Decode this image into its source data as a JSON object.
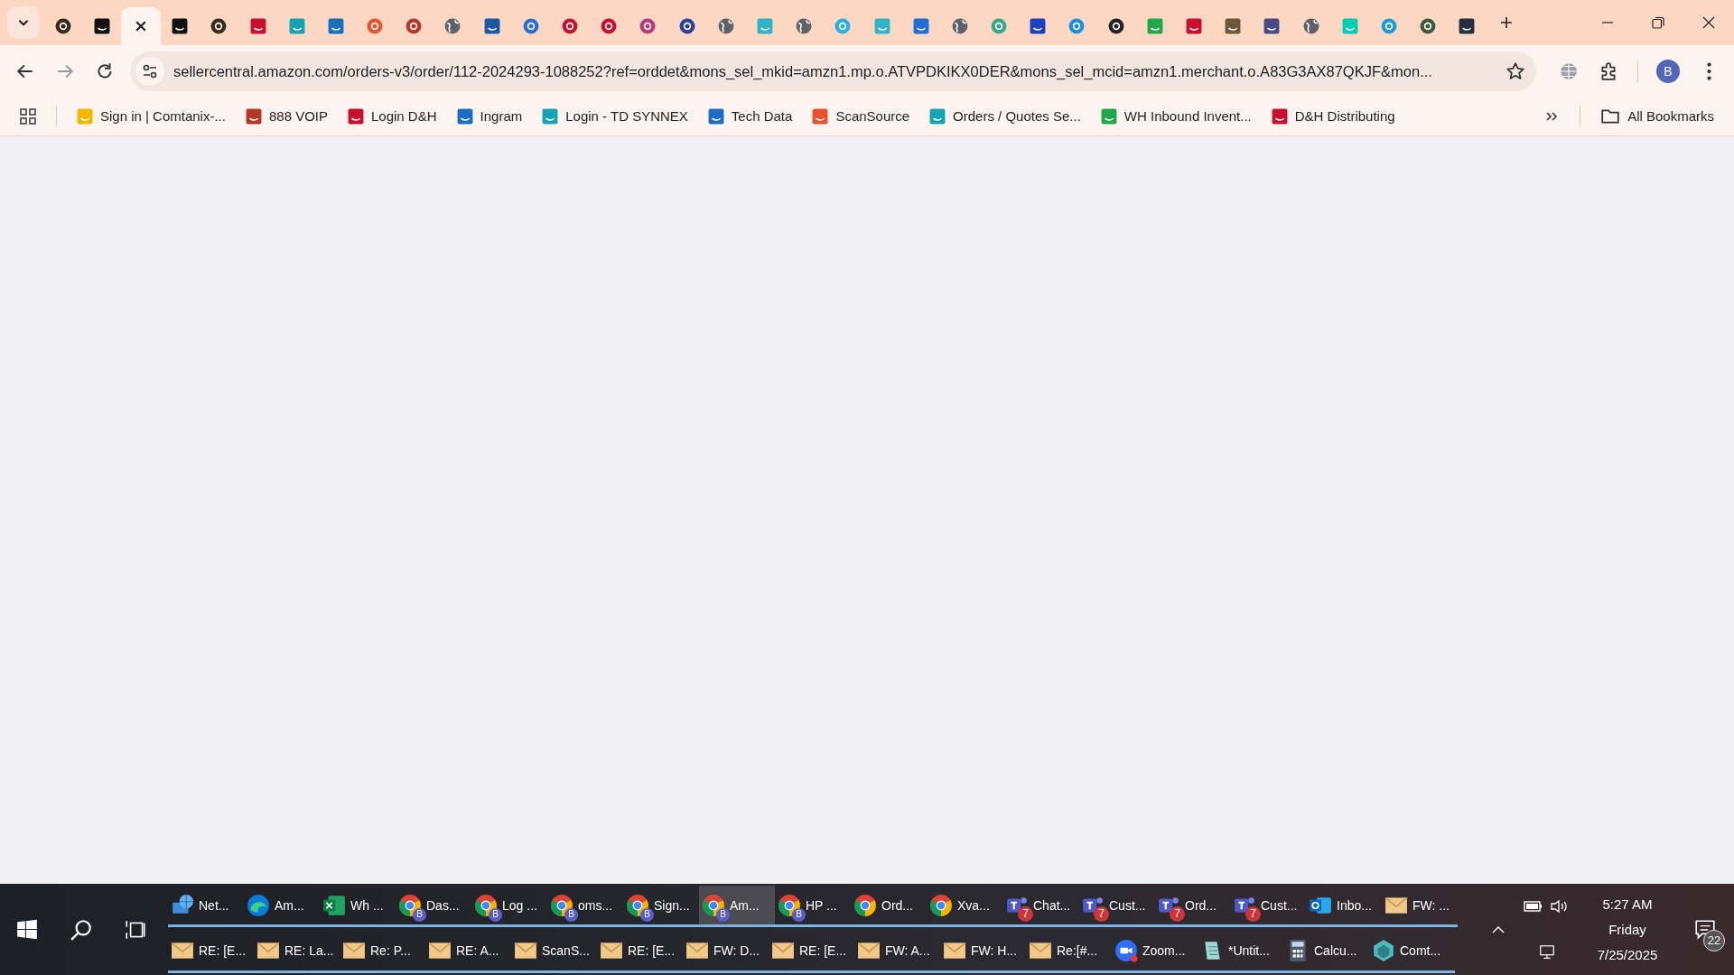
{
  "tabs": [
    {
      "kind": "circle",
      "color": "#3a2a1a",
      "selected": false
    },
    {
      "kind": "square",
      "color": "#111111",
      "selected": false
    },
    {
      "kind": "close",
      "selected": true
    },
    {
      "kind": "square",
      "color": "#111111",
      "selected": false
    },
    {
      "kind": "circle",
      "color": "#3a2a1a",
      "selected": false
    },
    {
      "kind": "square",
      "color": "#c8102e",
      "selected": false
    },
    {
      "kind": "square",
      "color": "#16a3b5",
      "selected": false
    },
    {
      "kind": "square",
      "color": "#1b6fc2",
      "selected": false
    },
    {
      "kind": "circle",
      "color": "#e8532f",
      "selected": false
    },
    {
      "kind": "circle",
      "color": "#b5372a",
      "selected": false
    },
    {
      "kind": "globe",
      "color": "#5f6368",
      "selected": false
    },
    {
      "kind": "square",
      "color": "#1a5aa8",
      "selected": false
    },
    {
      "kind": "circle",
      "color": "#2a6fd1",
      "selected": false
    },
    {
      "kind": "circle",
      "color": "#c8102e",
      "selected": false
    },
    {
      "kind": "circle",
      "color": "#c8102e",
      "selected": false
    },
    {
      "kind": "circle",
      "color": "#b83a7a",
      "selected": false
    },
    {
      "kind": "circle",
      "color": "#2a3f9e",
      "selected": false
    },
    {
      "kind": "globe",
      "color": "#5f6368",
      "selected": false
    },
    {
      "kind": "square",
      "color": "#2fb4c8",
      "selected": false
    },
    {
      "kind": "globe",
      "color": "#5f6368",
      "selected": false
    },
    {
      "kind": "circle",
      "color": "#2ab0e0",
      "selected": false
    },
    {
      "kind": "square",
      "color": "#2fb4c8",
      "selected": false
    },
    {
      "kind": "square",
      "color": "#1e6fd9",
      "selected": false
    },
    {
      "kind": "globe",
      "color": "#5f6368",
      "selected": false
    },
    {
      "kind": "circle",
      "color": "#3aa68a",
      "selected": false
    },
    {
      "kind": "square",
      "color": "#1f3fbf",
      "selected": false
    },
    {
      "kind": "circle",
      "color": "#1b8fe0",
      "selected": false
    },
    {
      "kind": "circle",
      "color": "#222222",
      "selected": false
    },
    {
      "kind": "square",
      "color": "#1ea84a",
      "selected": false
    },
    {
      "kind": "square",
      "color": "#c8102e",
      "selected": false
    },
    {
      "kind": "square",
      "color": "#6b5a3a",
      "selected": false
    },
    {
      "kind": "square",
      "color": "#4a4a8a",
      "selected": false
    },
    {
      "kind": "globe",
      "color": "#5f6368",
      "selected": false
    },
    {
      "kind": "square",
      "color": "#00d0b0",
      "selected": false
    },
    {
      "kind": "circle",
      "color": "#1e9bd7",
      "selected": false
    },
    {
      "kind": "circle",
      "color": "#3f5a3a",
      "selected": false
    },
    {
      "kind": "square",
      "color": "#232f3e",
      "selected": false
    }
  ],
  "address_bar": {
    "url": "sellercentral.amazon.com/orders-v3/order/112-2024293-1088252?ref=orddet&mons_sel_mkid=amzn1.mp.o.ATVPDKIKX0DER&mons_sel_mcid=amzn1.merchant.o.A83G3AX87QKJF&mon..."
  },
  "profile": {
    "initial": "B"
  },
  "bookmarks": [
    {
      "label": "Sign in | Comtanix-...",
      "color": "#f2b800"
    },
    {
      "label": "888 VOIP",
      "color": "#b5372a"
    },
    {
      "label": "Login D&H",
      "color": "#c8102e"
    },
    {
      "label": "Ingram",
      "color": "#1b6fc2"
    },
    {
      "label": "Login - TD SYNNEX",
      "color": "#16a3b5"
    },
    {
      "label": "Tech Data",
      "color": "#1a6fc2"
    },
    {
      "label": "ScanSource",
      "color": "#e8532f"
    },
    {
      "label": "Orders / Quotes Se...",
      "color": "#16a3b5"
    },
    {
      "label": "WH Inbound Invent...",
      "color": "#1ea84a"
    },
    {
      "label": "D&H Distributing",
      "color": "#c8102e"
    }
  ],
  "all_bookmarks": "All Bookmarks",
  "taskbar": {
    "row_1": [
      {
        "label": "Net...",
        "kind": "network",
        "selected": false
      },
      {
        "label": "Am...",
        "kind": "edge",
        "selected": false
      },
      {
        "label": "Wh ...",
        "kind": "excel",
        "selected": false
      },
      {
        "label": "Das...",
        "kind": "chrome",
        "badge": "B",
        "selected": false
      },
      {
        "label": "Log ...",
        "kind": "chrome",
        "badge": "B",
        "selected": false
      },
      {
        "label": "oms...",
        "kind": "chrome",
        "badge": "B",
        "selected": false
      },
      {
        "label": "Sign...",
        "kind": "chrome",
        "badge": "B",
        "selected": false
      },
      {
        "label": "Am...",
        "kind": "chrome",
        "badge": "B",
        "selected": true
      },
      {
        "label": "HP ...",
        "kind": "chrome",
        "badge": "B",
        "selected": false
      },
      {
        "label": "Ord...",
        "kind": "chrome",
        "selected": false
      },
      {
        "label": "Xva...",
        "kind": "chrome",
        "selected": false
      },
      {
        "label": "Chat...",
        "kind": "teams",
        "badge": "7",
        "selected": false
      },
      {
        "label": "Cust...",
        "kind": "teams",
        "badge": "7",
        "selected": false
      },
      {
        "label": "Ord...",
        "kind": "teams",
        "badge": "7",
        "selected": false
      },
      {
        "label": "Cust...",
        "kind": "teams",
        "badge": "7",
        "selected": false
      },
      {
        "label": "Inbo...",
        "kind": "outlook",
        "selected": false
      },
      {
        "label": "FW: ...",
        "kind": "mail",
        "selected": false
      }
    ],
    "row_2": [
      {
        "label": "RE: [E...",
        "kind": "mail",
        "selected": false
      },
      {
        "label": "RE: La...",
        "kind": "mail",
        "selected": false
      },
      {
        "label": "Re: P...",
        "kind": "mail",
        "selected": false
      },
      {
        "label": "RE: A...",
        "kind": "mail",
        "selected": false
      },
      {
        "label": "ScanS...",
        "kind": "mail",
        "selected": false
      },
      {
        "label": "RE: [E...",
        "kind": "mail",
        "selected": false
      },
      {
        "label": "FW: D...",
        "kind": "mail",
        "selected": false
      },
      {
        "label": "RE: [E...",
        "kind": "mail",
        "selected": false
      },
      {
        "label": "FW: A...",
        "kind": "mail",
        "selected": false
      },
      {
        "label": "FW: H...",
        "kind": "mail",
        "selected": false
      },
      {
        "label": "Re:[#...",
        "kind": "mail",
        "selected": false
      },
      {
        "label": "Zoom...",
        "kind": "zoom",
        "selected": false
      },
      {
        "label": "*Untit...",
        "kind": "notepad",
        "selected": false
      },
      {
        "label": "Calcu...",
        "kind": "calculator",
        "selected": false
      },
      {
        "label": "Comt...",
        "kind": "app",
        "selected": false
      }
    ]
  },
  "clock": {
    "time": "5:27 AM",
    "day": "Friday",
    "date": "7/25/2025"
  },
  "notifications": {
    "count": "22"
  }
}
